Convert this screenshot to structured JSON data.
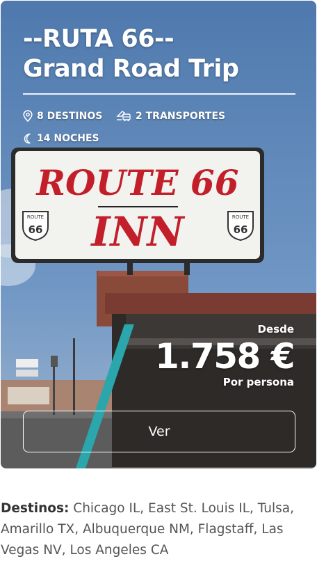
{
  "card": {
    "title_line1": "--RUTA 66--",
    "title_line2": "Grand Road Trip",
    "destinos_count": "8 DESTINOS",
    "transportes_count": "2 TRANSPORTES",
    "noches_count": "14 NOCHES",
    "price_prefix": "Desde",
    "price": "1.758 €",
    "price_suffix": "Por persona",
    "button_label": "Ver",
    "sign_top": "ROUTE 66",
    "sign_bottom": "INN",
    "shield_small_top": "ROUTE",
    "shield_small_num": "66"
  },
  "description": {
    "label": "Destinos:",
    "text": " Chicago IL, East St. Louis IL, Tulsa, Amarillo TX, Albuquerque NM, Flagstaff, Las Vegas NV, Los Angeles CA"
  },
  "icons": {
    "destinos": "map-pin-icon",
    "transportes": "transport-icon",
    "noches": "moon-icon"
  },
  "colors": {
    "sign_red": "#c21f2a",
    "sky": "#5d86b8",
    "text_gray": "#555555"
  }
}
